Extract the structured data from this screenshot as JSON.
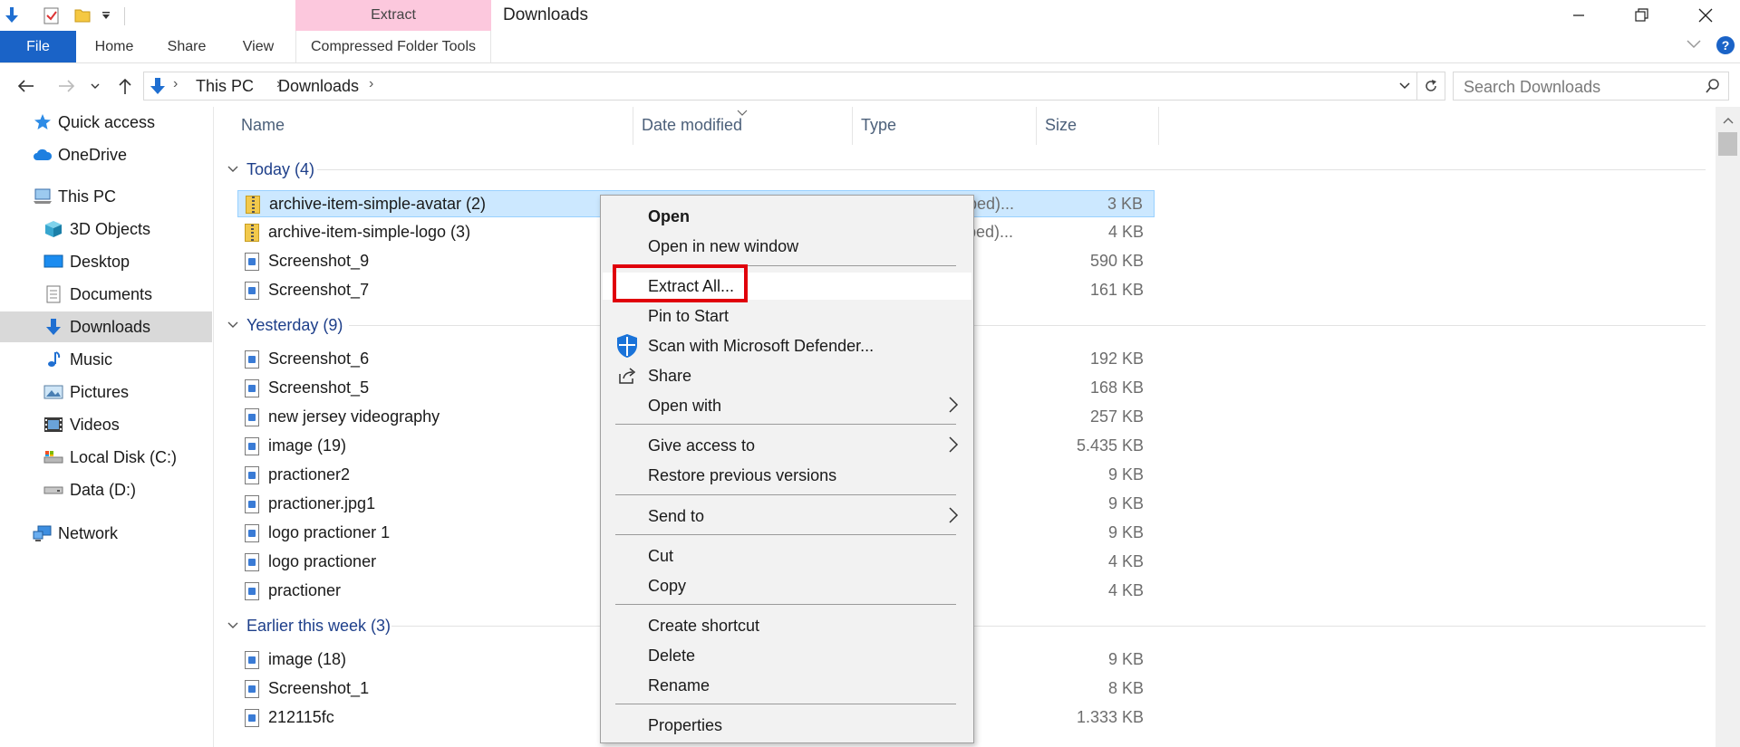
{
  "window": {
    "title": "Downloads",
    "contextual_tab_group": "Extract",
    "controls": {
      "minimize": "minimize-icon",
      "restore": "restore-icon",
      "close": "close-icon"
    }
  },
  "quick_access_toolbar": [
    "down-arrow-icon",
    "properties-check-icon",
    "new-folder-icon",
    "customize-dropdown-icon"
  ],
  "ribbon": {
    "tabs": [
      {
        "label": "File"
      },
      {
        "label": "Home"
      },
      {
        "label": "Share"
      },
      {
        "label": "View"
      },
      {
        "label": "Compressed Folder Tools"
      }
    ]
  },
  "address": {
    "crumbs": [
      "This PC",
      "Downloads"
    ],
    "search_placeholder": "Search Downloads"
  },
  "nav": {
    "items": [
      {
        "label": "Quick access",
        "icon": "star-icon"
      },
      {
        "label": "OneDrive",
        "icon": "cloud-icon"
      },
      {
        "label": "This PC",
        "icon": "computer-icon"
      },
      {
        "label": "3D Objects",
        "icon": "cube-icon"
      },
      {
        "label": "Desktop",
        "icon": "desktop-icon"
      },
      {
        "label": "Documents",
        "icon": "documents-icon"
      },
      {
        "label": "Downloads",
        "icon": "download-icon",
        "selected": true
      },
      {
        "label": "Music",
        "icon": "music-note-icon"
      },
      {
        "label": "Pictures",
        "icon": "pictures-icon"
      },
      {
        "label": "Videos",
        "icon": "video-icon"
      },
      {
        "label": "Local Disk (C:)",
        "icon": "drive-icon"
      },
      {
        "label": "Data (D:)",
        "icon": "drive-icon"
      },
      {
        "label": "Network",
        "icon": "network-icon"
      }
    ]
  },
  "columns": {
    "name": "Name",
    "date": "Date modified",
    "type": "Type",
    "size": "Size"
  },
  "groups": [
    {
      "label": "Today (4)",
      "files": [
        {
          "name": "archive-item-simple-avatar (2)",
          "type": "pped)...",
          "size": "3 KB",
          "kind": "zip",
          "selected": true
        },
        {
          "name": "archive-item-simple-logo (3)",
          "type": "pped)...",
          "size": "4 KB",
          "kind": "zip"
        },
        {
          "name": "Screenshot_9",
          "type": "",
          "size": "590 KB",
          "kind": "image"
        },
        {
          "name": "Screenshot_7",
          "type": "",
          "size": "161 KB",
          "kind": "image"
        }
      ]
    },
    {
      "label": "Yesterday (9)",
      "files": [
        {
          "name": "Screenshot_6",
          "size": "192 KB",
          "kind": "image"
        },
        {
          "name": "Screenshot_5",
          "size": "168 KB",
          "kind": "image"
        },
        {
          "name": "new jersey videography",
          "size": "257 KB",
          "kind": "image"
        },
        {
          "name": "image (19)",
          "size": "5.435 KB",
          "kind": "image"
        },
        {
          "name": "practioner2",
          "size": "9 KB",
          "kind": "image"
        },
        {
          "name": "practioner.jpg1",
          "size": "9 KB",
          "kind": "image"
        },
        {
          "name": "logo practioner 1",
          "size": "9 KB",
          "kind": "image"
        },
        {
          "name": "logo practioner",
          "size": "4 KB",
          "kind": "image"
        },
        {
          "name": "practioner",
          "size": "4 KB",
          "kind": "image"
        }
      ]
    },
    {
      "label": "Earlier this week (3)",
      "files": [
        {
          "name": "image (18)",
          "size": "9 KB",
          "kind": "image"
        },
        {
          "name": "Screenshot_1",
          "size": "8 KB",
          "kind": "image"
        },
        {
          "name": "212115fc",
          "size": "1.333 KB",
          "kind": "image"
        }
      ]
    }
  ],
  "context_menu": {
    "items": [
      {
        "label": "Open",
        "bold": true
      },
      {
        "label": "Open in new window"
      },
      {
        "sep": true
      },
      {
        "label": "Extract All...",
        "highlighted": true
      },
      {
        "label": "Pin to Start"
      },
      {
        "label": "Scan with Microsoft Defender...",
        "icon": "defender-shield-icon"
      },
      {
        "label": "Share",
        "icon": "share-icon"
      },
      {
        "label": "Open with",
        "submenu": true
      },
      {
        "sep": true
      },
      {
        "label": "Give access to",
        "submenu": true
      },
      {
        "label": "Restore previous versions"
      },
      {
        "sep": true
      },
      {
        "label": "Send to",
        "submenu": true
      },
      {
        "sep": true
      },
      {
        "label": "Cut"
      },
      {
        "label": "Copy"
      },
      {
        "sep": true
      },
      {
        "label": "Create shortcut"
      },
      {
        "label": "Delete"
      },
      {
        "label": "Rename"
      },
      {
        "sep": true
      },
      {
        "label": "Properties"
      }
    ]
  },
  "colors": {
    "file_tab": "#1a63c7",
    "contextual_tab": "#fcc8dd",
    "selection": "#cce8ff",
    "highlight_box": "#e0000b",
    "group_header": "#1e3f8a"
  }
}
